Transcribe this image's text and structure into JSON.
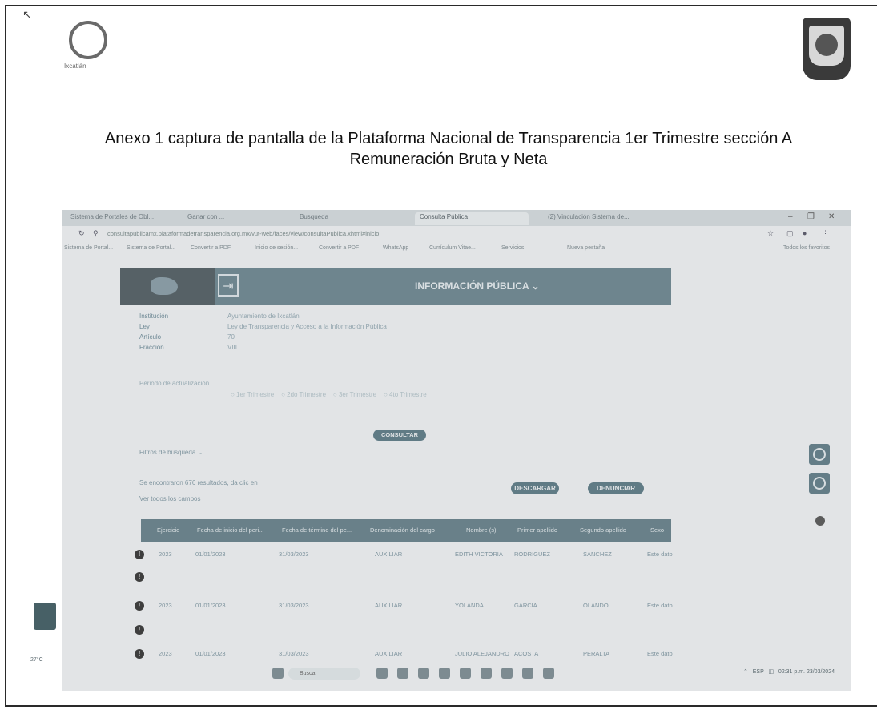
{
  "doc": {
    "title_line1": "Anexo 1 captura de pantalla de la Plataforma Nacional de Transparencia 1er Trimestre sección A",
    "title_line2": "Remuneración Bruta y Neta",
    "logo_text": "Ixcatlán"
  },
  "browser": {
    "tabs": [
      "Sistema de Portales de Obl...",
      "Ganar con ...",
      "Busqueda",
      "Consulta Pública",
      "(2) Vinculación Sistema de..."
    ],
    "url": "consultapublicamx.plataformadetransparencia.org.mx/vut-web/faces/view/consultaPublica.xhtml#inicio",
    "bookmarks": [
      "Sistema de Portal...",
      "Sistema de Portal...",
      "Convertir a PDF",
      "Inicio de sesión...",
      "Convertir a PDF",
      "WhatsApp",
      "Currículum Vitae...",
      "Servicios",
      "Nueva pestaña"
    ],
    "bookmarks_folder": "Todos los favoritos"
  },
  "portal": {
    "banner_label": "INFORMACIÓN PÚBLICA",
    "meta": [
      {
        "k": "Institución",
        "v": "Ayuntamiento de Ixcatlán"
      },
      {
        "k": "Ley",
        "v": "Ley de Transparencia y Acceso a la Información Pública"
      },
      {
        "k": "Artículo",
        "v": "70"
      },
      {
        "k": "Fracción",
        "v": "VIII"
      }
    ],
    "periodo_label": "Periodo de actualización",
    "consultar": "CONSULTAR",
    "filtros": "Filtros de búsqueda",
    "results_text": "Se encontraron 676 resultados, da clic en",
    "see_all": "Ver todos los campos",
    "descargar": "DESCARGAR",
    "denunciar": "DENUNCIAR"
  },
  "table": {
    "headers": [
      "Ejercicio",
      "Fecha de inicio del peri...",
      "Fecha de término del pe...",
      "Denominación del cargo",
      "Nombre (s)",
      "Primer apellido",
      "Segundo apellido",
      "Sexo"
    ],
    "rows": [
      [
        "2023",
        "01/01/2023",
        "31/03/2023",
        "AUXILIAR",
        "EDITH VICTORIA",
        "RODRIGUEZ",
        "SANCHEZ",
        "Este dato"
      ],
      [
        "",
        "",
        "",
        "",
        "",
        "",
        "",
        ""
      ],
      [
        "2023",
        "01/01/2023",
        "31/03/2023",
        "AUXILIAR",
        "YOLANDA",
        "GARCIA",
        "OLANDO",
        "Este dato"
      ],
      [
        "",
        "",
        "",
        "",
        "",
        "",
        "",
        ""
      ],
      [
        "2023",
        "01/01/2023",
        "31/03/2023",
        "AUXILIAR",
        "JULIO ALEJANDRO",
        "ACOSTA",
        "PERALTA",
        "Este dato"
      ]
    ]
  },
  "taskbar": {
    "search": "Buscar",
    "tray_time": "02:31 p.m.",
    "tray_date": "23/03/2024",
    "weather": "27°C"
  }
}
